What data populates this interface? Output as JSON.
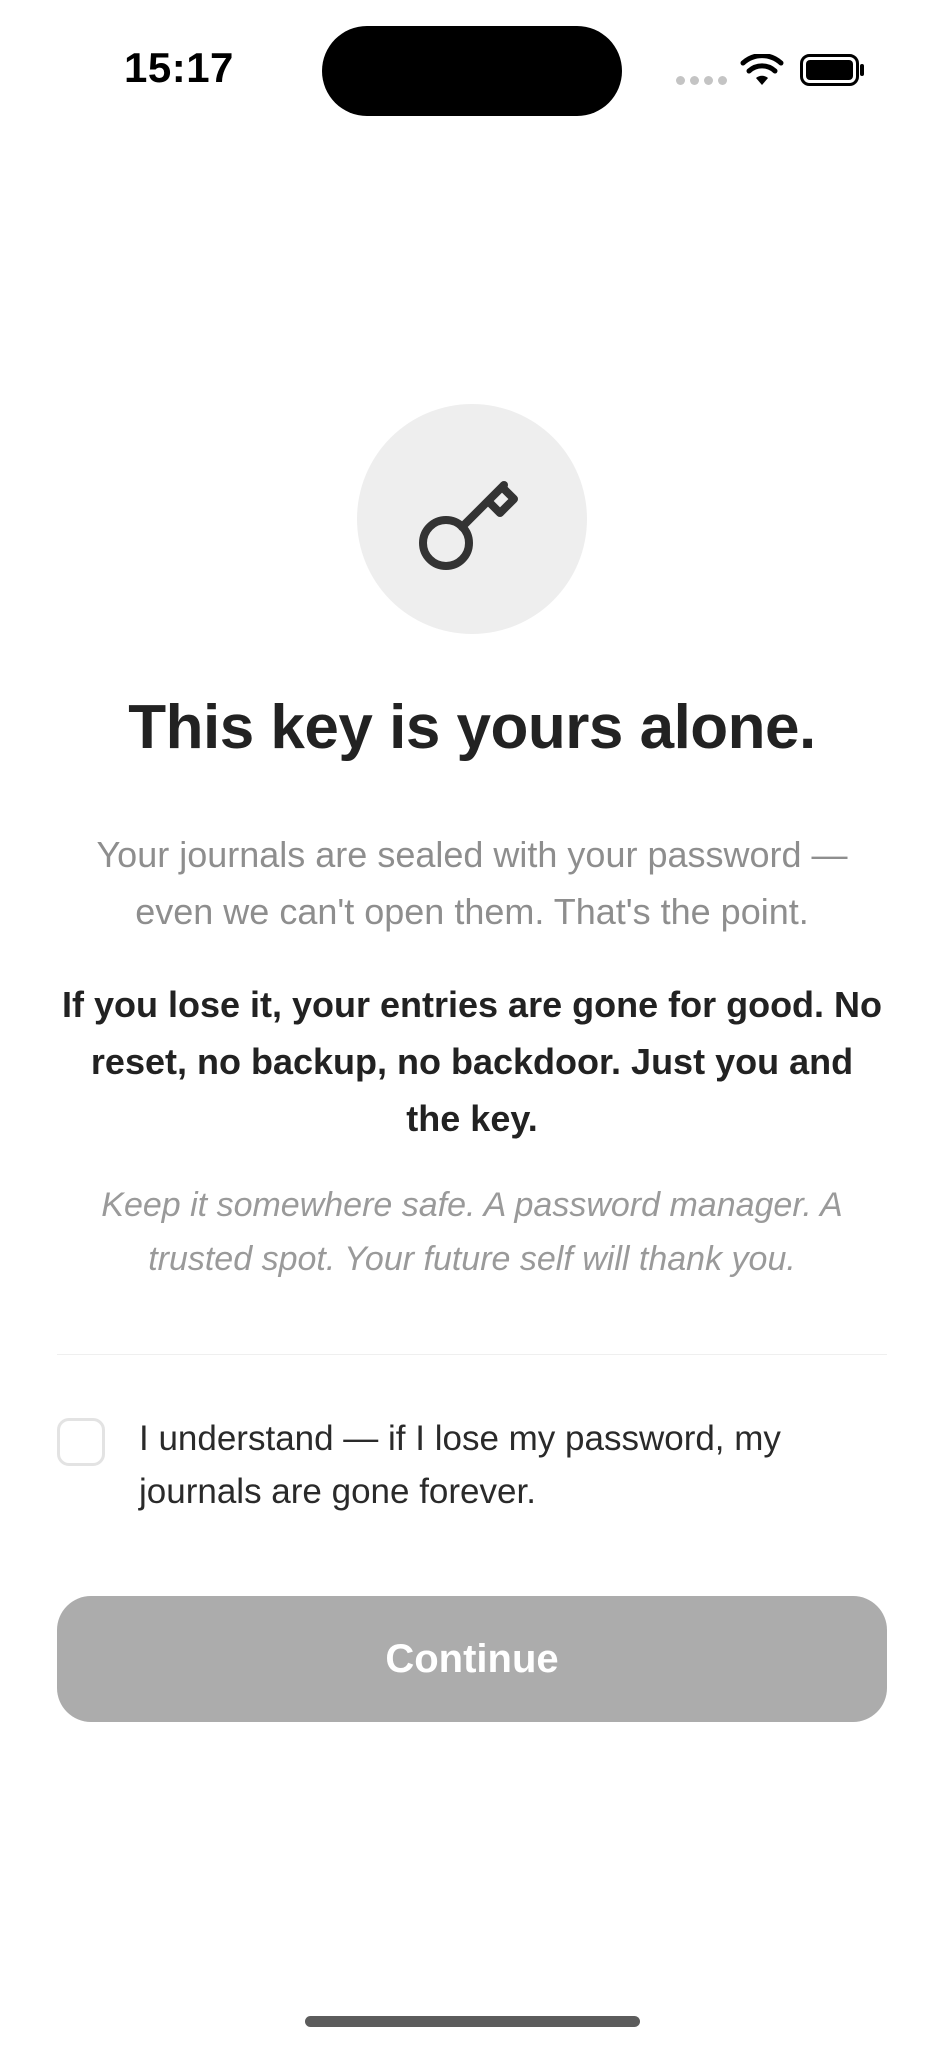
{
  "status_bar": {
    "time": "15:17",
    "icons": [
      "signal-dots-icon",
      "wifi-icon",
      "battery-icon"
    ]
  },
  "hero": {
    "icon": "key-icon",
    "title": "This key is yours alone."
  },
  "body": {
    "intro": "Your journals are sealed with your password — even we can't open them. That's the point.",
    "warning": "If you lose it, your entries are gone for good. No reset, no backup, no backdoor. Just you and the key.",
    "tip": "Keep it somewhere safe. A password manager. A trusted spot. Your future self will thank you."
  },
  "acknowledgement": {
    "checked": false,
    "label": "I understand — if I lose my password, my journals are gone forever."
  },
  "actions": {
    "continue_label": "Continue",
    "continue_enabled": false
  },
  "colors": {
    "button_disabled": "#acacac",
    "icon_circle": "#eeeeee",
    "muted_text": "#8e8e8e"
  }
}
